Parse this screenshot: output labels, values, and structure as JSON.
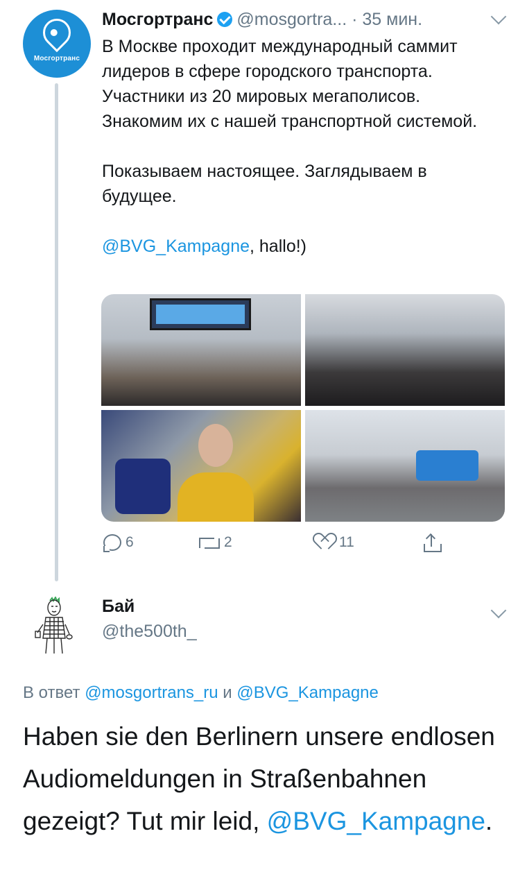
{
  "tweet1": {
    "avatar_text": "Мосгортранс",
    "name": "Мосгортранс",
    "handle": "@mosgortra...",
    "time": "· 35 мин.",
    "paragraph1": "В Москве проходит международный саммит лидеров в сфере городского транспорта. Участники из 20 мировых мегаполисов. Знакомим их с нашей транспортной системой.",
    "paragraph2": "Показываем настоящее. Заглядываем в будущее.",
    "mention": "@BVG_Kampagne",
    "mention_suffix": ", hallo!)",
    "actions": {
      "replies": "6",
      "retweets": "2",
      "likes": "11"
    }
  },
  "tweet2": {
    "name": "Бай",
    "handle": "@the500th_",
    "reply_prefix": "В ответ",
    "reply_user1": "@mosgortrans_ru",
    "reply_and": "и",
    "reply_user2": "@BVG_Kampagne",
    "text": "Haben sie den Berlinern unsere endlosen Audiomeldungen in Straßenbahnen gezeigt? Tut mir leid,",
    "mention": "@BVG_Kampagne",
    "mention_suffix": "."
  },
  "colors": {
    "link": "#1b95e0",
    "secondary": "#657786",
    "verified": "#1da1f2",
    "avatar_bg": "#1d8fd6"
  }
}
